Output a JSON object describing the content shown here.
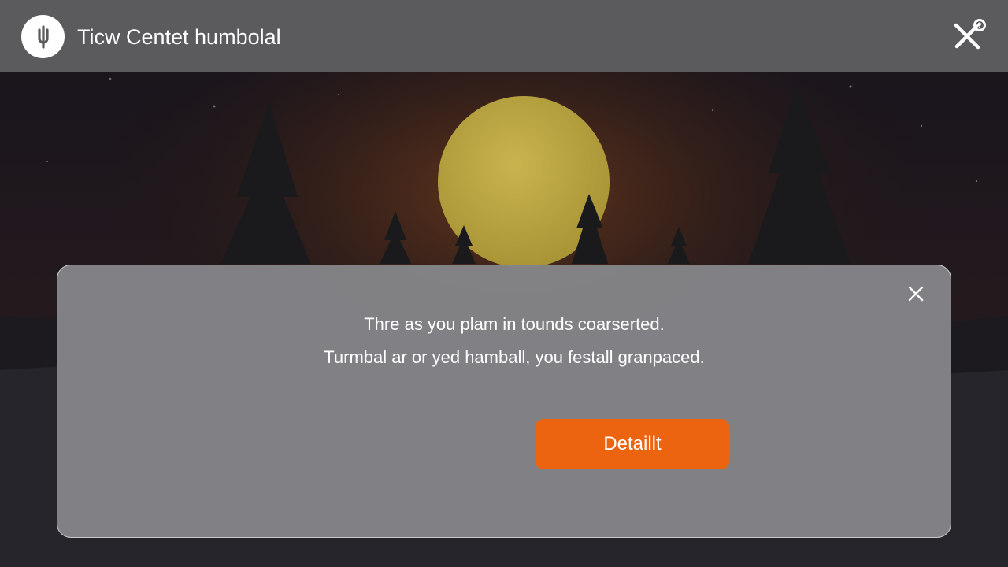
{
  "header": {
    "title": "Ticw Centet humbolal",
    "app_icon": "power-plug-icon",
    "tools_icon": "tools-help-icon"
  },
  "dialog": {
    "line1": "Thre as you plam in tounds coarserted.",
    "line2": "Turmbal ar or yed hamball, you festall granpaced.",
    "primary_button_label": "Detaillt",
    "close_icon": "close-icon"
  },
  "colors": {
    "topbar": "#5b5b5d",
    "dialog_bg": "#848488",
    "accent": "#ec6410",
    "moon": "#bba645"
  }
}
